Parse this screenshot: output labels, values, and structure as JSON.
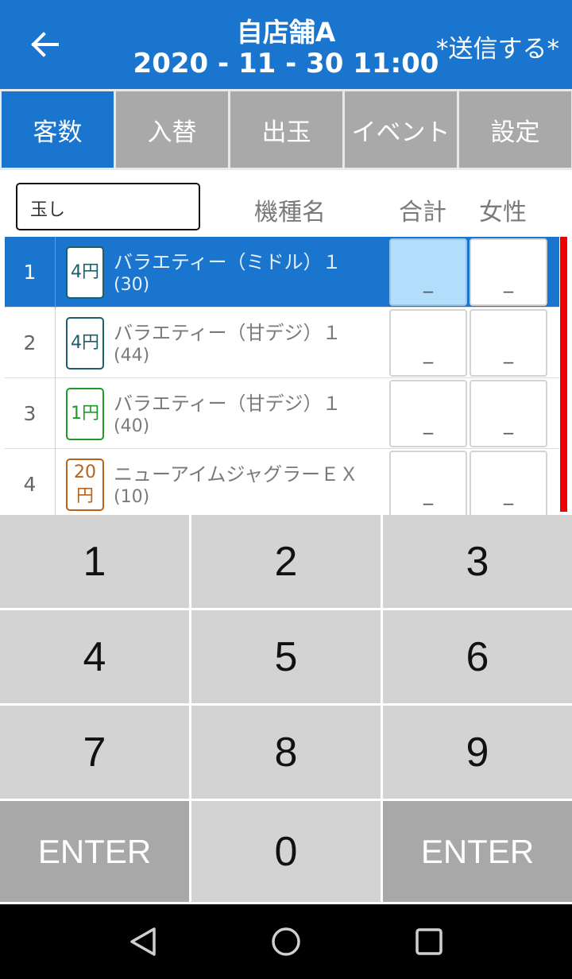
{
  "header": {
    "title": "自店舗A",
    "datetime": "2020 - 11 - 30 11:00",
    "send_label": "*送信する*"
  },
  "tabs": [
    {
      "label": "客数",
      "active": true
    },
    {
      "label": "入替",
      "active": false
    },
    {
      "label": "出玉",
      "active": false
    },
    {
      "label": "イベント",
      "active": false
    },
    {
      "label": "設定",
      "active": false
    }
  ],
  "list_header": {
    "filter_value": "玉し",
    "col_name": "機種名",
    "col_total": "合計",
    "col_female": "女性"
  },
  "rows": [
    {
      "num": "1",
      "rate": "4円",
      "rate_color": "#1a5f6b",
      "name": "バラエティー（ミドル）１",
      "count": "(30)",
      "total": "_",
      "female": "_",
      "selected": true
    },
    {
      "num": "2",
      "rate": "4円",
      "rate_color": "#1a5f6b",
      "name": "バラエティー（甘デジ）１",
      "count": "(44)",
      "total": "_",
      "female": "_",
      "selected": false
    },
    {
      "num": "3",
      "rate": "1円",
      "rate_color": "#1f9a2a",
      "name": "バラエティー（甘デジ）１",
      "count": "(40)",
      "total": "_",
      "female": "_",
      "selected": false
    },
    {
      "num": "4",
      "rate": "20円",
      "rate_color": "#b8621a",
      "name": "ニューアイムジャグラーＥＸ",
      "count": "(10)",
      "total": "_",
      "female": "_",
      "selected": false
    }
  ],
  "keypad": {
    "k1": "1",
    "k2": "2",
    "k3": "3",
    "k4": "4",
    "k5": "5",
    "k6": "6",
    "k7": "7",
    "k8": "8",
    "k9": "9",
    "enter_left": "ENTER",
    "k0": "0",
    "enter_right": "ENTER"
  },
  "colors": {
    "accent": "#1a75cf",
    "tab_inactive": "#a9a9a9",
    "selected_cell": "#b3defb",
    "indicator": "#ee0000"
  }
}
